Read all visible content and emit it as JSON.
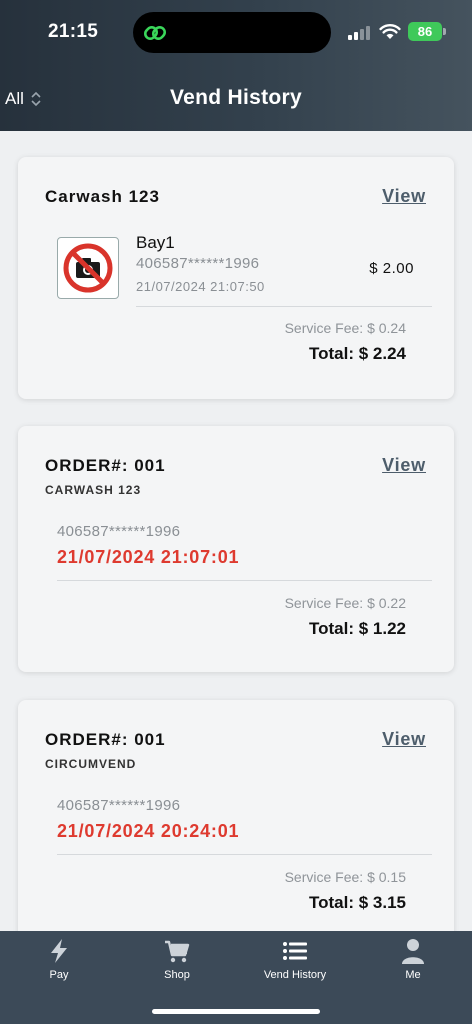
{
  "status_bar": {
    "time": "21:15",
    "battery": "86"
  },
  "header": {
    "filter_label": "All",
    "title": "Vend History"
  },
  "colors": {
    "header": "#2c3945",
    "tabbar": "#3c4a58",
    "accent_red": "#de3a2f",
    "link": "#4d5d6b"
  },
  "cards": [
    {
      "title": "Carwash 123",
      "view_label": "View",
      "item": {
        "name": "Bay1",
        "card_number": "406587******1996",
        "date": "21/07/2024 21:07:50",
        "price": "$ 2.00",
        "icon": "no-camera-icon"
      },
      "service_fee": "Service Fee: $ 0.24",
      "total": "Total: $ 2.24"
    },
    {
      "title": "ORDER#: 001",
      "subtitle": "CARWASH 123",
      "view_label": "View",
      "card_number": "406587******1996",
      "date": "21/07/2024 21:07:01",
      "service_fee": "Service Fee: $ 0.22",
      "total": "Total: $ 1.22"
    },
    {
      "title": "ORDER#: 001",
      "subtitle": "CIRCUMVEND",
      "view_label": "View",
      "card_number": "406587******1996",
      "date": "21/07/2024 20:24:01",
      "service_fee": "Service Fee: $ 0.15",
      "total": "Total: $ 3.15"
    }
  ],
  "tabs": [
    {
      "label": "Pay",
      "icon": "lightning-icon"
    },
    {
      "label": "Shop",
      "icon": "cart-icon"
    },
    {
      "label": "Vend History",
      "icon": "list-icon",
      "active": true
    },
    {
      "label": "Me",
      "icon": "person-icon"
    }
  ]
}
